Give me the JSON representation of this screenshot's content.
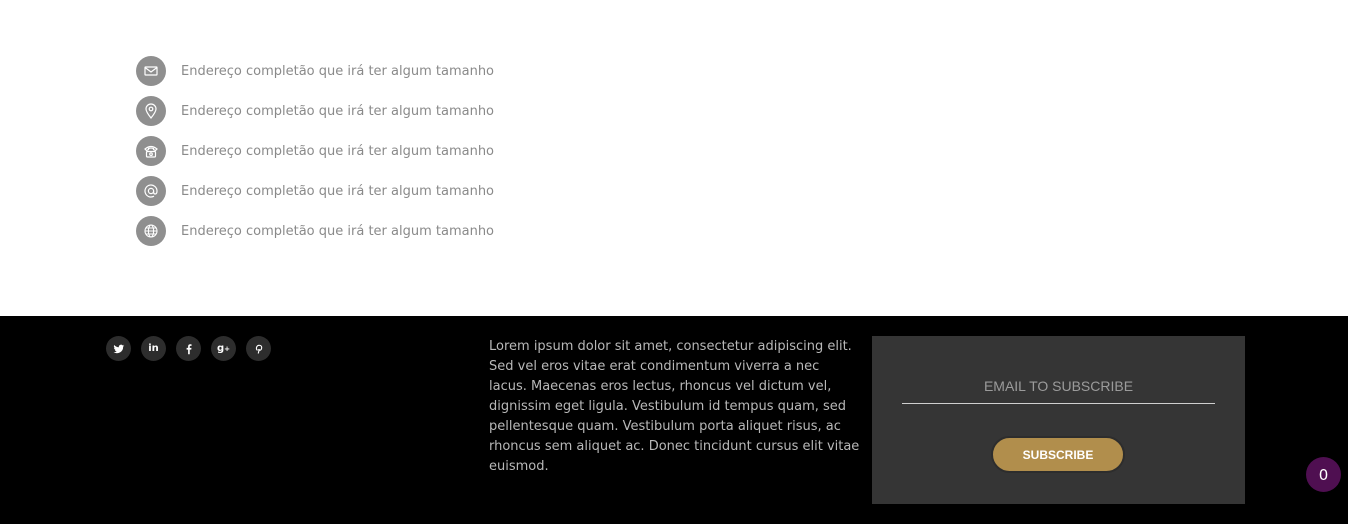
{
  "contact": {
    "items": [
      {
        "icon": "envelope-icon",
        "text": "Endereço completão que irá ter algum tamanho"
      },
      {
        "icon": "map-pin-icon",
        "text": "Endereço completão que irá ter algum tamanho"
      },
      {
        "icon": "phone-icon",
        "text": "Endereço completão que irá ter algum tamanho"
      },
      {
        "icon": "at-sign-icon",
        "text": "Endereço completão que irá ter algum tamanho"
      },
      {
        "icon": "globe-icon",
        "text": "Endereço completão que irá ter algum tamanho"
      }
    ]
  },
  "footer": {
    "social": [
      "twitter-icon",
      "linkedin-icon",
      "facebook-icon",
      "google-plus-icon",
      "pinterest-icon"
    ],
    "about_text": "Lorem ipsum dolor sit amet, consectetur adipiscing elit. Sed vel eros vitae erat condimentum viverra a nec lacus. Maecenas eros lectus, rhoncus vel dictum vel, dignissim eget ligula. Vestibulum id tempus quam, sed pellentesque quam. Vestibulum porta aliquet risus, ac rhoncus sem aliquet ac. Donec tincidunt cursus elit vitae euismod.",
    "subscribe": {
      "placeholder": "EMAIL TO SUBSCRIBE",
      "button_label": "SUBSCRIBE"
    }
  },
  "cart": {
    "count": "0"
  },
  "colors": {
    "icon_bg": "#8f8f8f",
    "footer_bg": "#000000",
    "subscribe_bg": "#353535",
    "accent": "#b18e4c",
    "badge": "#4f0f51"
  }
}
